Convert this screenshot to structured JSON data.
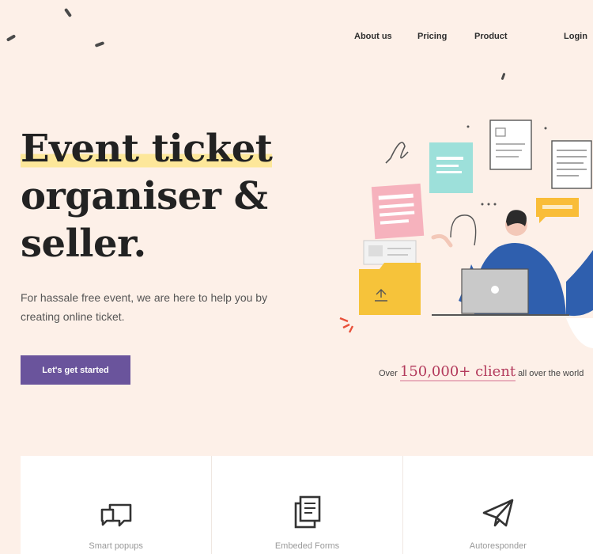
{
  "nav": {
    "links": [
      "About us",
      "Pricing",
      "Product"
    ],
    "login": "Login"
  },
  "hero": {
    "title_line1": "Event ticket",
    "title_line2": "organiser &",
    "title_line3": "seller.",
    "subtitle": "For hassale free event, we are here to help you by creating online ticket.",
    "cta_label": "Let's get started"
  },
  "clients": {
    "prefix": "Over",
    "count": "150,000+ client",
    "suffix": "all over the world"
  },
  "features": [
    {
      "label": "Smart popups",
      "icon": "chat-bubbles-icon"
    },
    {
      "label": "Embeded Forms",
      "icon": "documents-icon"
    },
    {
      "label": "Autoresponder",
      "icon": "paper-plane-icon"
    }
  ],
  "colors": {
    "background": "#fdf0e8",
    "accent": "#6a549c",
    "highlight": "#fde79a",
    "client_count": "#b33a5c"
  }
}
